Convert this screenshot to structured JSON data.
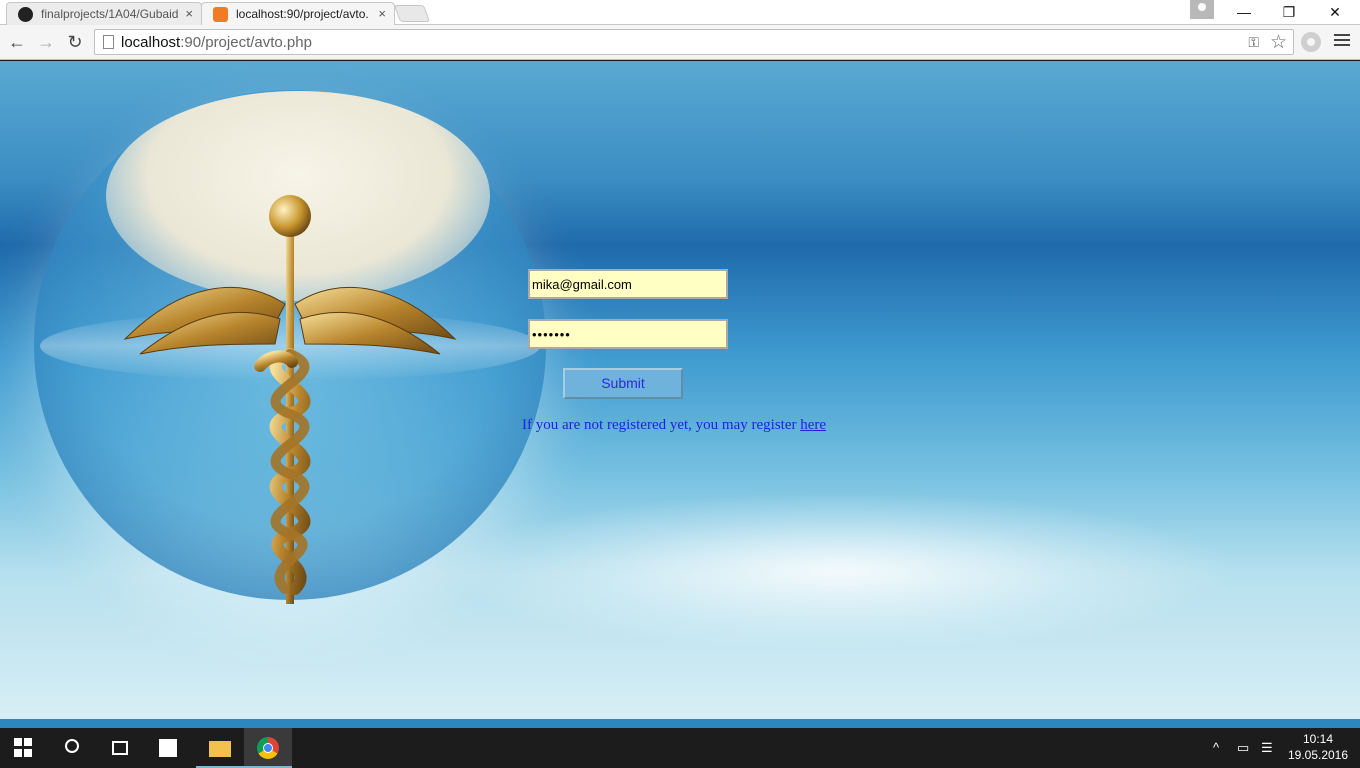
{
  "browser": {
    "tabs": [
      {
        "title": "finalprojects/1A04/Gubaid",
        "favicon": "github-icon",
        "active": false
      },
      {
        "title": "localhost:90/project/avto.",
        "favicon": "xampp-icon",
        "active": true
      }
    ],
    "close_glyph": "×",
    "window_controls": {
      "minimize": "—",
      "maximize": "❐",
      "close": "✕"
    },
    "nav": {
      "back": "←",
      "forward": "→",
      "reload": "↻"
    },
    "address": {
      "host": "localhost",
      "rest": ":90/project/avto.php"
    },
    "icons": {
      "key": "⚿",
      "star": "☆"
    }
  },
  "login": {
    "email_value": "mika@gmail.com",
    "password_value": "•••••••",
    "submit_label": "Submit",
    "register_text": "If you are not registered yet, you may register ",
    "register_link": "here"
  },
  "colors": {
    "field_background": "#ffffc4",
    "link_color": "#2222dd",
    "button_background": "#6fb2dc"
  },
  "taskbar": {
    "apps": [
      "start",
      "search",
      "task-view",
      "store",
      "file-explorer",
      "chrome"
    ],
    "tray": {
      "chevron": "^",
      "battery": "▭",
      "notifications": "☰"
    },
    "clock": {
      "time": "10:14",
      "date": "19.05.2016"
    }
  }
}
